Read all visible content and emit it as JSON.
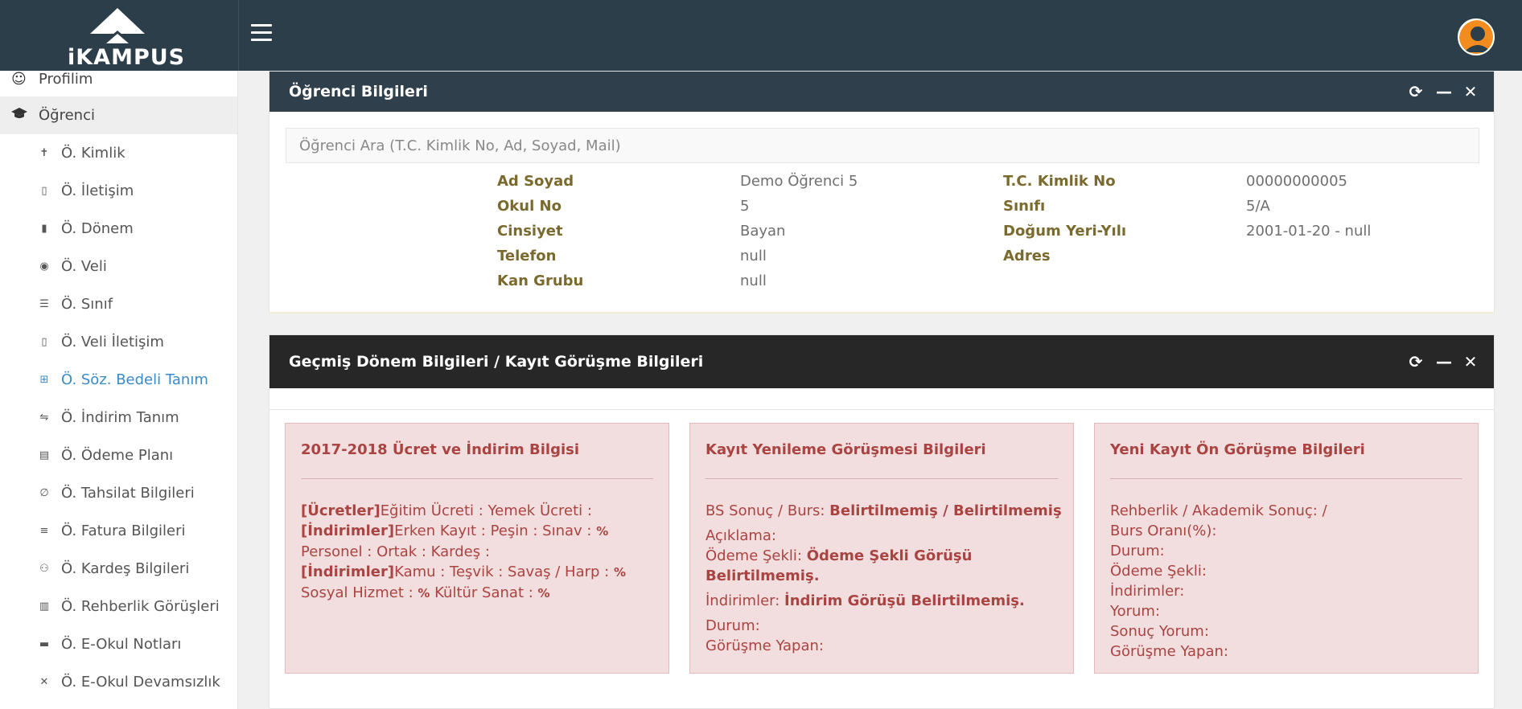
{
  "app": {
    "logo_text": "iKAMPUS"
  },
  "sidebar": {
    "items": [
      {
        "label": "Profilim",
        "icon": "smile-icon"
      },
      {
        "label": "Öğrenci",
        "icon": "graduation-cap-icon"
      },
      {
        "label": "Ö. Kimlik",
        "icon": "person-icon"
      },
      {
        "label": "Ö. İletişim",
        "icon": "mobile-icon"
      },
      {
        "label": "Ö. Dönem",
        "icon": "book-icon"
      },
      {
        "label": "Ö. Veli",
        "icon": "eye-icon"
      },
      {
        "label": "Ö. Sınıf",
        "icon": "storage-icon"
      },
      {
        "label": "Ö. Veli İletişim",
        "icon": "mobile-icon"
      },
      {
        "label": "Ö. Söz. Bedeli Tanım",
        "icon": "note-add-icon"
      },
      {
        "label": "Ö. İndirim Tanım",
        "icon": "swap-icon"
      },
      {
        "label": "Ö. Ödeme Planı",
        "icon": "list-box-icon"
      },
      {
        "label": "Ö. Tahsilat Bilgileri",
        "icon": "link-icon"
      },
      {
        "label": "Ö. Fatura Bilgileri",
        "icon": "lines-icon"
      },
      {
        "label": "Ö. Kardeş Bilgileri",
        "icon": "people-icon"
      },
      {
        "label": "Ö. Rehberlik Görüşleri",
        "icon": "chart-icon"
      },
      {
        "label": "Ö. E-Okul Notları",
        "icon": "layout-icon"
      },
      {
        "label": "Ö. E-Okul Devamsızlık",
        "icon": "close-icon"
      }
    ]
  },
  "student_panel": {
    "title": "Öğrenci Bilgileri",
    "search_placeholder": "Öğrenci Ara (T.C. Kimlik No, Ad, Soyad, Mail)",
    "rows": [
      {
        "k1": "Ad Soyad",
        "v1": "Demo Öğrenci 5",
        "k2": "T.C. Kimlik No",
        "v2": "00000000005"
      },
      {
        "k1": "Okul No",
        "v1": "5",
        "k2": "Sınıfı",
        "v2": "5/A"
      },
      {
        "k1": "Cinsiyet",
        "v1": "Bayan",
        "k2": "Doğum Yeri-Yılı",
        "v2": "2001-01-20 - null"
      },
      {
        "k1": "Telefon",
        "v1": "null",
        "k2": "Adres",
        "v2": ""
      },
      {
        "k1": "Kan Grubu",
        "v1": "null",
        "k2": "",
        "v2": ""
      }
    ]
  },
  "history_panel": {
    "title": "Geçmiş Dönem Bilgileri / Kayıt Görüşme Bilgileri",
    "card1": {
      "title": "2017-2018 Ücret ve İndirim Bilgisi",
      "ucretler_tag": "[Ücretler]",
      "ucretler_text": "Eğitim Ücreti :  Yemek Ücreti :",
      "indirimler1_tag": "[İndirimler]",
      "indirimler1_text_a": "Erken Kayıt :  Peşin :  Sınav : ",
      "indirimler1_pct": "%",
      "indirimler1_text_b": " Personel :  Ortak :  Kardeş :",
      "indirimler2_tag": "[İndirimler]",
      "indirimler2_text_a": "Kamu :  Teşvik :  Savaş / Harp : ",
      "indirimler2_pct_a": "%",
      "indirimler2_text_b": " Sosyal Hizmet : ",
      "indirimler2_pct_b": "%",
      "indirimler2_text_c": " Kültür Sanat : ",
      "indirimler2_pct_c": "%"
    },
    "card2": {
      "title": "Kayıt Yenileme Görüşmesi Bilgileri",
      "bs_label": "BS Sonuç / Burs: ",
      "bs_value": "Belirtilmemiş / Belirtilmemiş",
      "aciklama": "Açıklama:",
      "odeme_label": "Ödeme Şekli: ",
      "odeme_value": "Ödeme Şekli Görüşü Belirtilmemiş.",
      "indirim_label": "İndirimler: ",
      "indirim_value": "İndirim Görüşü Belirtilmemiş.",
      "durum": "Durum:",
      "gorusme_yapan": "Görüşme Yapan:"
    },
    "card3": {
      "title": "Yeni Kayıt Ön Görüşme Bilgileri",
      "lines": [
        "Rehberlik / Akademik Sonuç:  /",
        "Burs Oranı(%):",
        "Durum:",
        "Ödeme Şekli:",
        "İndirimler:",
        "Yorum:",
        "Sonuç Yorum:",
        "Görüşme Yapan:"
      ]
    }
  },
  "tools": {
    "refresh": "⟳",
    "minimize": "—",
    "close": "✕"
  },
  "colors": {
    "topbar": "#2c3e4a",
    "panel1_head": "#2f3f4b",
    "panel2_head": "#272727",
    "card_bg": "#f2dede",
    "card_text": "#a94442",
    "active_link": "#3a8bc7",
    "avatar": "#f28c1e"
  }
}
